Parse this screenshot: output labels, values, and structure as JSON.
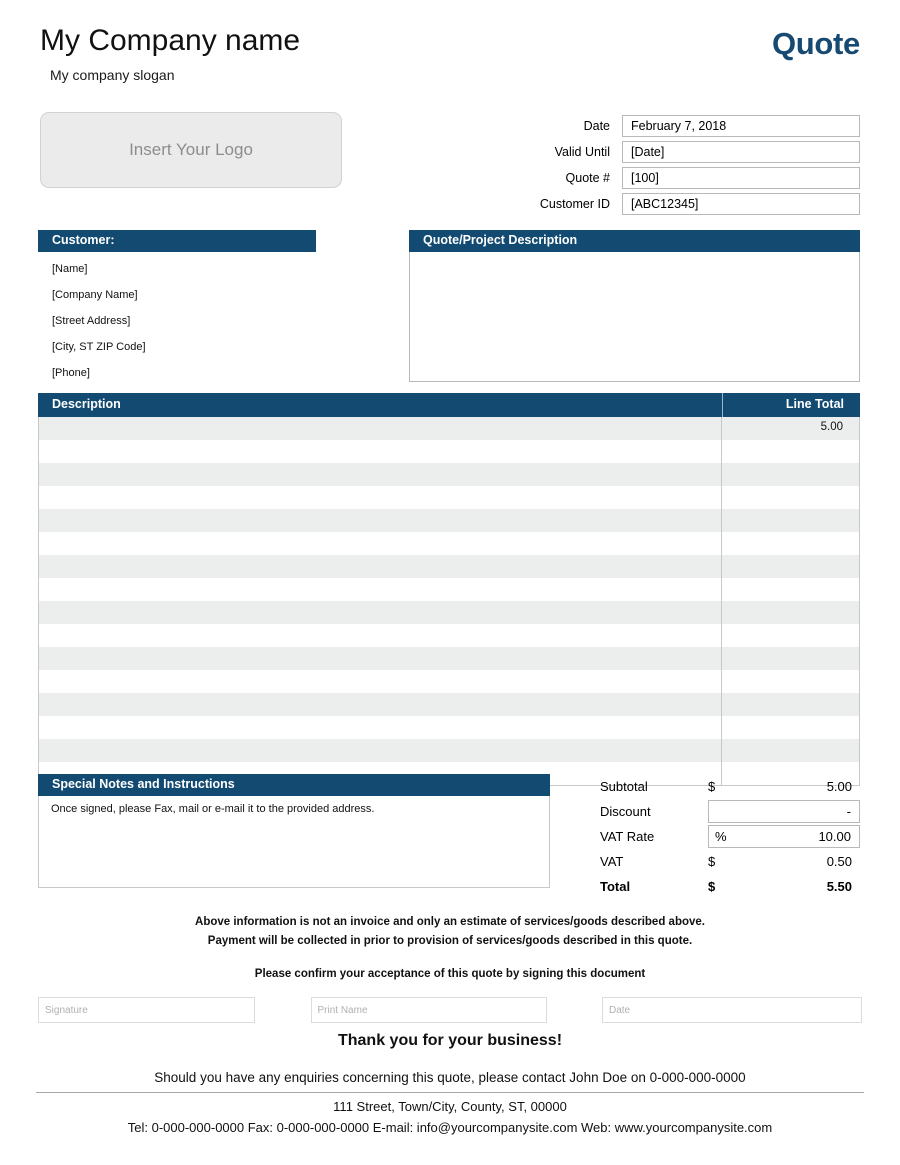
{
  "colors": {
    "accent_navy": "#124a72",
    "title_navy": "#174a72",
    "row_stripe": "#eceded",
    "logo_fill": "#ebebeb",
    "border_gray": "#c8c8c8"
  },
  "header": {
    "company_name": "My Company name",
    "company_slogan": "My company slogan",
    "document_title": "Quote"
  },
  "logo": {
    "placeholder_label": "Insert Your Logo"
  },
  "meta": {
    "rows": [
      {
        "label": "Date",
        "value": "February 7, 2018"
      },
      {
        "label": "Valid Until",
        "value": "[Date]"
      },
      {
        "label": "Quote #",
        "value": "[100]"
      },
      {
        "label": "Customer ID",
        "value": "[ABC12345]"
      }
    ]
  },
  "customer": {
    "heading": "Customer:",
    "lines": [
      "[Name]",
      "[Company Name]",
      "[Street Address]",
      "[City, ST  ZIP Code]",
      "[Phone]"
    ]
  },
  "quote_description": {
    "heading": "Quote/Project Description",
    "body": ""
  },
  "items_table": {
    "columns": [
      "Description",
      "Line Total"
    ],
    "rows": [
      {
        "description": "",
        "line_total": "5.00"
      },
      {
        "description": "",
        "line_total": ""
      },
      {
        "description": "",
        "line_total": ""
      },
      {
        "description": "",
        "line_total": ""
      },
      {
        "description": "",
        "line_total": ""
      },
      {
        "description": "",
        "line_total": ""
      },
      {
        "description": "",
        "line_total": ""
      },
      {
        "description": "",
        "line_total": ""
      },
      {
        "description": "",
        "line_total": ""
      },
      {
        "description": "",
        "line_total": ""
      },
      {
        "description": "",
        "line_total": ""
      },
      {
        "description": "",
        "line_total": ""
      },
      {
        "description": "",
        "line_total": ""
      },
      {
        "description": "",
        "line_total": ""
      },
      {
        "description": "",
        "line_total": ""
      },
      {
        "description": "",
        "line_total": ""
      }
    ]
  },
  "notes": {
    "heading": "Special Notes and Instructions",
    "text": "Once signed, please Fax, mail or e-mail it to the provided address."
  },
  "totals": {
    "subtotal": {
      "label": "Subtotal",
      "currency": "$",
      "value": "5.00"
    },
    "discount": {
      "label": "Discount",
      "currency": "",
      "value": "-"
    },
    "vat_rate": {
      "label": "VAT Rate",
      "currency": "%",
      "value": "10.00"
    },
    "vat": {
      "label": "VAT",
      "currency": "$",
      "value": "0.50"
    },
    "total": {
      "label": "Total",
      "currency": "$",
      "value": "5.50"
    }
  },
  "disclaimer": {
    "line1": "Above information is not an invoice and only an estimate of services/goods described above.",
    "line2": "Payment will be collected in prior to provision of services/goods described in this quote.",
    "confirm": "Please confirm your acceptance of this quote by signing this document"
  },
  "signature": {
    "signature_placeholder": "Signature",
    "print_name_placeholder": "Print Name",
    "date_placeholder": "Date"
  },
  "footer": {
    "thanks": "Thank you for your business!",
    "enquiries": "Should you have any enquiries concerning this quote, please contact John Doe on 0-000-000-0000",
    "address": "111 Street, Town/City, County, ST, 00000",
    "contact": "Tel: 0-000-000-0000 Fax: 0-000-000-0000 E-mail: info@yourcompanysite.com Web: www.yourcompanysite.com"
  }
}
